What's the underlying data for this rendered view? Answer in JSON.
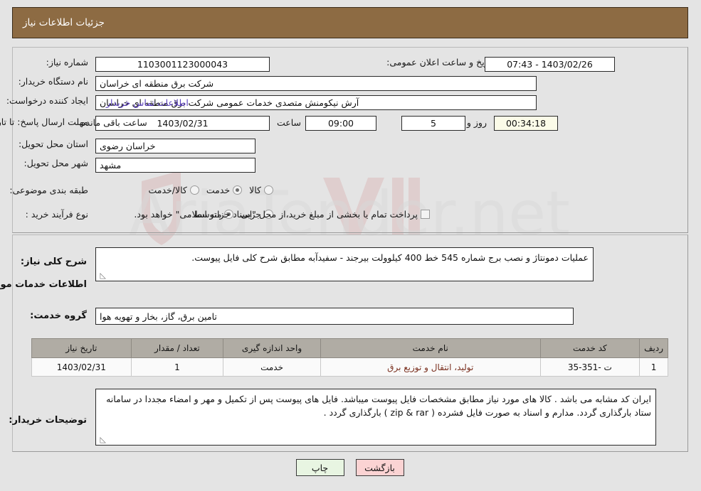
{
  "header": {
    "title": "جزئیات اطلاعات نیاز",
    "bar_color": "#8d6b43"
  },
  "top_form": {
    "need_number_label": "شماره نیاز:",
    "need_number_value": "1103001123000043",
    "announce_datetime_label": "تاریخ و ساعت اعلان عمومی:",
    "announce_datetime_value": "1403/02/26 - 07:43",
    "buyer_org_label": "نام دستگاه خریدار:",
    "buyer_org_value": "شرکت برق منطقه ای خراسان",
    "requester_label": "ایجاد کننده درخواست:",
    "requester_value": "آرش نیکومنش متصدی خدمات عمومی شرکت برق منطقه ای خراسان",
    "contact_link": "اطلاعات تماس خریدار",
    "deadline_label": "مهلت ارسال پاسخ: تا تاریخ:",
    "deadline_date": "1403/02/31",
    "hour_label": "ساعت",
    "hour_value": "09:00",
    "days_value": "5",
    "days_label": "روز و",
    "countdown_value": "00:34:18",
    "countdown_label": "ساعت باقی مانده",
    "province_label": "استان محل تحویل:",
    "province_value": "خراسان رضوی",
    "city_label": "شهر محل تحویل:",
    "city_value": "مشهد",
    "category_label": "طبقه بندی موضوعی:",
    "category_options": [
      "کالا",
      "خدمت",
      "کالا/خدمت"
    ],
    "category_selected": "خدمت",
    "process_label": "نوع فرآیند خرید :",
    "process_options": [
      "جزیی",
      "متوسط"
    ],
    "process_selected": "متوسط",
    "treasury_checkbox_text": "پرداخت تمام یا بخشی از مبلغ خرید،از محل \"اسناد خزانه اسلامی\" خواهد بود.",
    "treasury_checked": false
  },
  "description": {
    "label": "شرح کلی نیاز:",
    "value": "عملیات دمونتاژ و نصب برج شماره 545 خط 400 کیلوولت بیرجند - سفیدآبه مطابق شرح کلی فایل پیوست."
  },
  "services_section": {
    "title": "اطلاعات خدمات مورد نیاز",
    "group_label": "گروه خدمت:",
    "group_value": "تامین برق، گاز، بخار و تهویه هوا"
  },
  "table": {
    "headers": [
      "ردیف",
      "کد خدمت",
      "نام خدمت",
      "واحد اندازه گیری",
      "تعداد / مقدار",
      "تاریخ نیاز"
    ],
    "rows": [
      {
        "row_no": "1",
        "service_code": "ت -351-35",
        "service_name": "تولید، انتقال و توزیع برق",
        "unit": "خدمت",
        "quantity": "1",
        "need_date": "1403/02/31"
      }
    ]
  },
  "buyer_notes": {
    "label": "توضیحات خریدار:",
    "value": "ایران کد مشابه می باشد . کالا های مورد نیاز مطابق مشخصات فایل پیوست میباشد. فایل های پیوست پس از تکمیل و مهر و امضاء مجددا در سامانه ستاد بارگذاری گردد. مدارم و اسناد به صورت فایل فشرده ( zip & rar ) بارگذاری گردد ."
  },
  "buttons": {
    "print": "چاپ",
    "back": "بازگشت"
  },
  "watermark": {
    "text": "AriaTender.net"
  }
}
